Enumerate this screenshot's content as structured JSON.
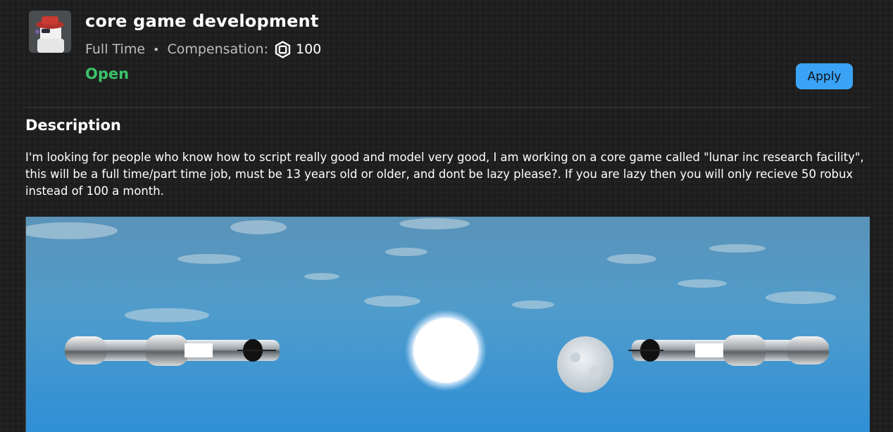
{
  "job": {
    "title": "core game development",
    "type": "Full Time",
    "separator": "•",
    "compensation_label": "Compensation:",
    "compensation_icon": "robux-icon",
    "compensation_amount": "100",
    "status": "Open",
    "status_color": "#3bc26a",
    "apply_label": "Apply",
    "apply_color": "#3aa3f5"
  },
  "description": {
    "heading": "Description",
    "text": "I'm looking for people who know how to script really good and model very good, I am working on a core game called \"lunar inc research facility\", this will be a full time/part time job, must be 13 years old or older, and dont be lazy please?. If you are lazy then you will only recieve 50 robux instead of 100 a month."
  }
}
